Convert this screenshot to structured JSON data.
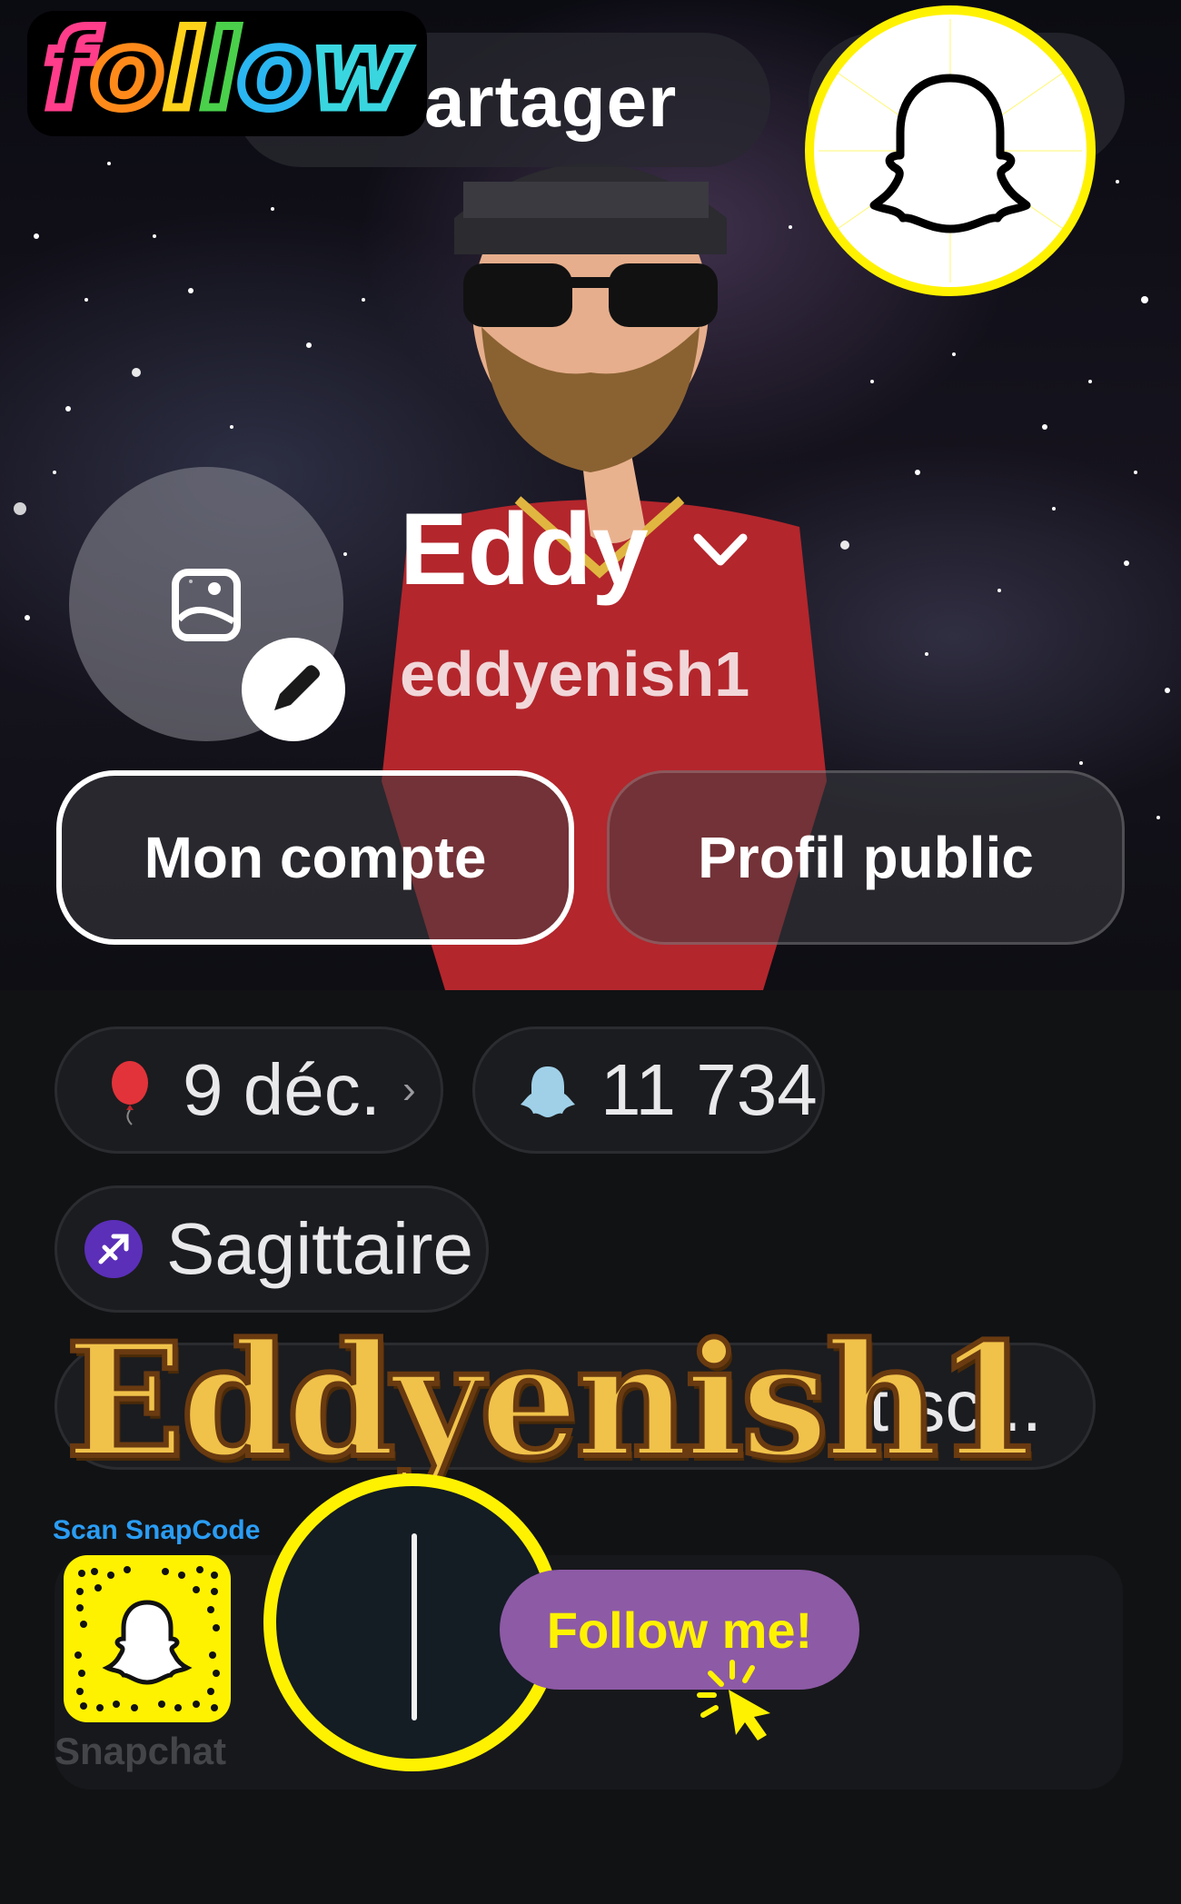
{
  "header": {
    "share_label": "artager",
    "follow_sticker_text": "follow"
  },
  "profile": {
    "display_name": "Eddy",
    "username": "eddyenish1",
    "account_button": "Mon compte",
    "public_profile_button": "Profil public"
  },
  "chips": {
    "birthday": "9 déc.",
    "snap_score": "11 734",
    "zodiac": "Sagittaire",
    "bio": "t sc..."
  },
  "overlay": {
    "name_banner": "Eddyenish1",
    "scan_label": "Scan SnapCode",
    "snapchat_word": "Snapchat",
    "follow_me": "Follow me!"
  },
  "colors": {
    "snap_yellow": "#fff200",
    "follow_purple": "#8d5aa6",
    "banner_gold": "#f0c24a"
  }
}
